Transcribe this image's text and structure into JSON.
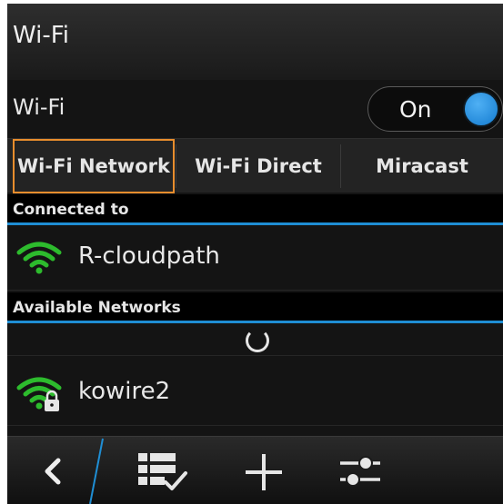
{
  "title": "Wi-Fi",
  "wifi_toggle": {
    "label": "Wi-Fi",
    "state_text": "On",
    "on": true
  },
  "tabs": [
    {
      "label": "Wi-Fi Network",
      "active": true
    },
    {
      "label": "Wi-Fi Direct",
      "active": false
    },
    {
      "label": "Miracast",
      "active": false
    }
  ],
  "connected": {
    "header": "Connected to",
    "network": {
      "name": "R-cloudpath",
      "icon": "wifi-signal-icon"
    }
  },
  "available": {
    "header": "Available Networks",
    "networks": [
      {
        "name": "kowire2",
        "icon": "wifi-locked-icon"
      }
    ]
  },
  "actions": [
    {
      "name": "back",
      "icon": "chevron-left-icon"
    },
    {
      "name": "select",
      "icon": "checklist-icon"
    },
    {
      "name": "add",
      "icon": "plus-icon"
    },
    {
      "name": "settings",
      "icon": "sliders-icon"
    }
  ],
  "colors": {
    "accent_blue": "#1f8ed4",
    "wifi_green": "#2dbb2d",
    "tab_highlight": "#e88d2d"
  }
}
